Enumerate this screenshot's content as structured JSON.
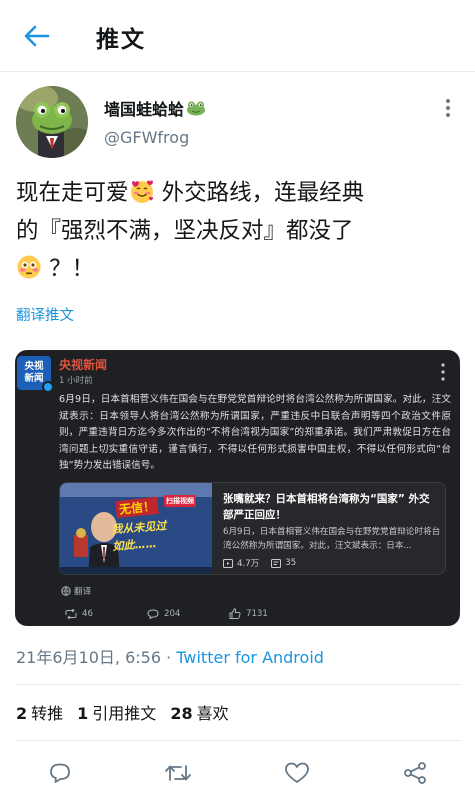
{
  "header": {
    "title": "推文"
  },
  "author": {
    "name": "墙国蛙蛤蛤",
    "handle": "@GFWfrog"
  },
  "tweet": {
    "line1_a": "现在走可爱",
    "line1_b": " 外交路线，连最经典",
    "line2": "的『强烈不满，坚决反对』都没了",
    "line3_b": " ？！",
    "translate_label": "翻译推文"
  },
  "embedded": {
    "logo_text": "央视\n新闻",
    "account": "央视新闻",
    "time": "1 小时前",
    "body": "6月9日，日本首相菅义伟在国会与在野党党首辩论时将台湾公然称为所谓国家。对此，汪文斌表示：日本领导人将台湾公然称为所谓国家，严重违反中日联合声明等四个政治文件原则，严重违背日方迄今多次作出的“不将台湾视为国家”的郑重承诺。我们严肃敦促日方在台湾问题上切实重信守诺，谨言慎行，不得以任何形式损害中国主权，不得以任何形式向“台独”势力发出错误信号。",
    "news": {
      "thumb_caption_1": "无信！",
      "thumb_caption_2": "我从未见过如此……",
      "thumb_badge": "扫描视频",
      "title": "张嘴就来？日本首相将台湾称为“国家” 外交部严正回应！",
      "desc": "6月9日，日本首相菅义伟在国会与在野党党首辩论时将台湾公然称为所谓国家。对此，汪文斌表示：日本...",
      "views": "4.7万",
      "comments": "35"
    },
    "translate_label": "翻译",
    "reposts": "46",
    "comments": "204",
    "likes": "7131"
  },
  "meta": {
    "datetime": "21年6月10日, 6:56 · ",
    "source": "Twitter for Android"
  },
  "stats": {
    "retweets_count": "2",
    "retweets_label": "转推",
    "quotes_count": "1",
    "quotes_label": "引用推文",
    "likes_count": "28",
    "likes_label": "喜欢"
  },
  "colors": {
    "accent": "#1b95e0",
    "card_bg": "#1f2023",
    "brand_red": "#e0533f"
  },
  "icons": [
    "back-arrow-icon",
    "more-vert-icon",
    "frog-emoji-icon",
    "smiling-hearts-emoji-icon",
    "flushed-emoji-icon",
    "reply-icon",
    "retweet-icon",
    "like-icon",
    "share-icon"
  ]
}
